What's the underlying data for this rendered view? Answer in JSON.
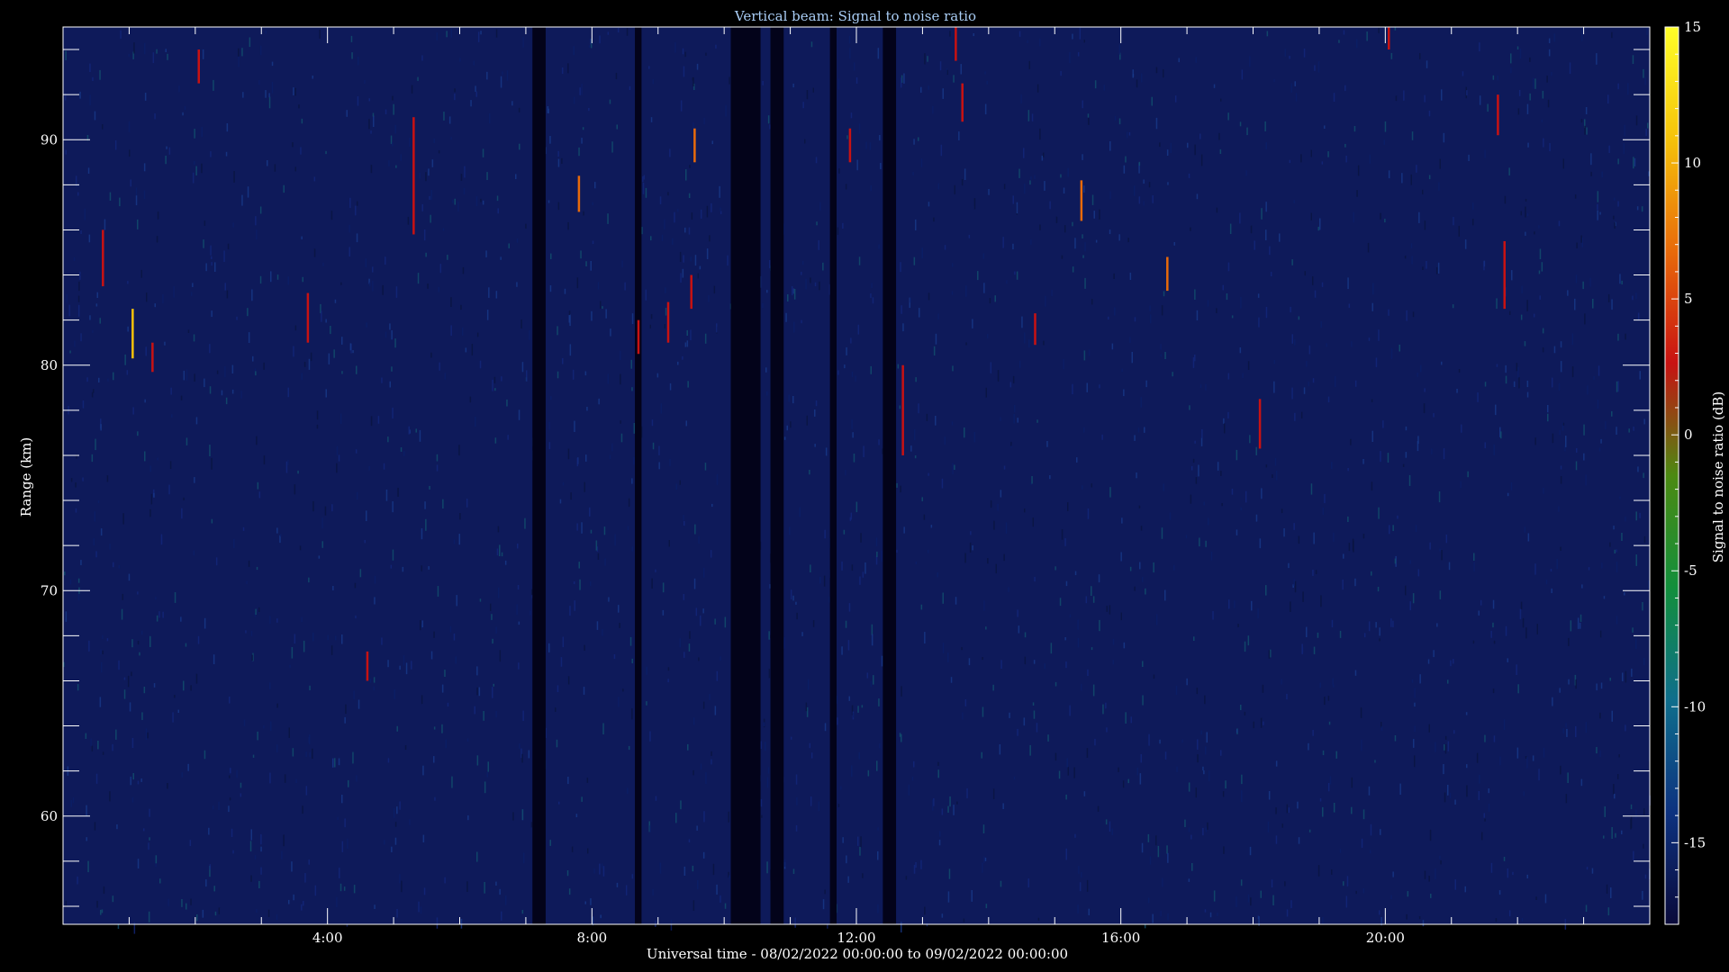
{
  "chart_data": {
    "type": "heatmap",
    "title": "Vertical beam: Signal to noise ratio",
    "xlabel": "Universal time - 08/02/2022 00:00:00 to 09/02/2022 00:00:00",
    "ylabel": "Range (km)",
    "colorbar_label": "Signal to noise ratio (dB)",
    "x_unit": "hours UT",
    "xlim": [
      0,
      24
    ],
    "ylim": [
      55.2,
      95
    ],
    "x_ticks": [
      4,
      8,
      12,
      16,
      20
    ],
    "x_tick_labels": [
      "4:00",
      "8:00",
      "12:00",
      "16:00",
      "20:00"
    ],
    "y_ticks": [
      60,
      70,
      80,
      90
    ],
    "y_tick_labels": [
      "60",
      "70",
      "80",
      "90"
    ],
    "colorbar_range": [
      -18,
      15
    ],
    "colorbar_ticks": [
      15,
      10,
      5,
      0,
      -5,
      -10,
      -15
    ],
    "colorbar_tick_labels": [
      "15",
      "10",
      "5",
      "0",
      "-5",
      "-10",
      "-15"
    ],
    "background_level_db": -15,
    "no_data_intervals": [
      [
        7.1,
        7.3
      ],
      [
        8.65,
        8.75
      ],
      [
        10.1,
        10.55
      ],
      [
        10.7,
        10.9
      ],
      [
        11.6,
        11.7
      ],
      [
        12.4,
        12.6
      ]
    ],
    "echoes": [
      {
        "t": 0.6,
        "r_top": 86.0,
        "r_bot": 83.5,
        "snr": 3
      },
      {
        "t": 1.05,
        "r_top": 82.5,
        "r_bot": 80.3,
        "snr": 9
      },
      {
        "t": 1.35,
        "r_top": 81.0,
        "r_bot": 79.7,
        "snr": 3
      },
      {
        "t": 2.05,
        "r_top": 94.0,
        "r_bot": 92.5,
        "snr": 3
      },
      {
        "t": 3.7,
        "r_top": 83.2,
        "r_bot": 81.0,
        "snr": 2
      },
      {
        "t": 4.6,
        "r_top": 67.3,
        "r_bot": 66.0,
        "snr": 2
      },
      {
        "t": 5.3,
        "r_top": 91.0,
        "r_bot": 85.8,
        "snr": 4
      },
      {
        "t": 7.8,
        "r_top": 88.4,
        "r_bot": 86.8,
        "snr": 6
      },
      {
        "t": 8.7,
        "r_top": 82.0,
        "r_bot": 80.5,
        "snr": 2
      },
      {
        "t": 9.15,
        "r_top": 82.8,
        "r_bot": 81.0,
        "snr": 4
      },
      {
        "t": 9.5,
        "r_top": 84.0,
        "r_bot": 82.5,
        "snr": 2
      },
      {
        "t": 9.55,
        "r_top": 90.5,
        "r_bot": 89.0,
        "snr": 5
      },
      {
        "t": 11.9,
        "r_top": 90.5,
        "r_bot": 89.0,
        "snr": 3
      },
      {
        "t": 12.7,
        "r_top": 80.0,
        "r_bot": 76.0,
        "snr": 3
      },
      {
        "t": 13.5,
        "r_top": 95.0,
        "r_bot": 93.5,
        "snr": 4
      },
      {
        "t": 13.6,
        "r_top": 92.5,
        "r_bot": 90.8,
        "snr": 2
      },
      {
        "t": 14.7,
        "r_top": 82.3,
        "r_bot": 80.9,
        "snr": 2
      },
      {
        "t": 15.4,
        "r_top": 88.2,
        "r_bot": 86.4,
        "snr": 6
      },
      {
        "t": 16.7,
        "r_top": 84.8,
        "r_bot": 83.3,
        "snr": 5
      },
      {
        "t": 18.1,
        "r_top": 78.5,
        "r_bot": 76.3,
        "snr": 2
      },
      {
        "t": 20.05,
        "r_top": 95.0,
        "r_bot": 94.0,
        "snr": 3
      },
      {
        "t": 21.7,
        "r_top": 92.0,
        "r_bot": 90.2,
        "snr": 2
      },
      {
        "t": 21.8,
        "r_top": 85.5,
        "r_bot": 82.5,
        "snr": 2
      }
    ],
    "colormap_hex": [
      "#0a0a3a",
      "#0d3280",
      "#0f6e8c",
      "#128f3c",
      "#4c8a12",
      "#c81212",
      "#e86a0a",
      "#f5c20a",
      "#ffff28"
    ]
  }
}
